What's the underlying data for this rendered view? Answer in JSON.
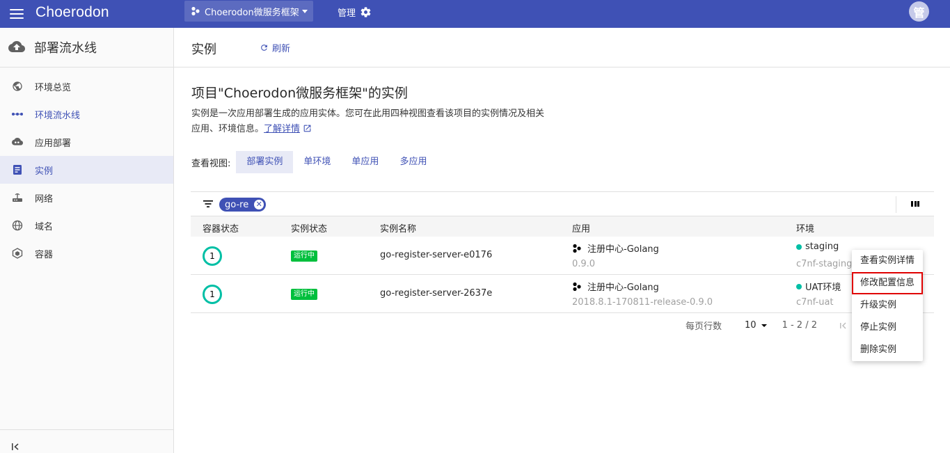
{
  "topbar": {
    "logo": "Choerodon",
    "project": "Choerodon微服务框架",
    "manage": "管理",
    "avatar": "管"
  },
  "sidebar": {
    "title": "部署流水线",
    "items": [
      {
        "label": "环境总览",
        "icon": "globe-icon"
      },
      {
        "label": "环境流水线",
        "icon": "pipeline-dots-icon"
      },
      {
        "label": "应用部署",
        "icon": "cloud-deploy-icon"
      },
      {
        "label": "实例",
        "icon": "instance-icon",
        "active": true
      },
      {
        "label": "网络",
        "icon": "router-icon"
      },
      {
        "label": "域名",
        "icon": "domain-globe-icon"
      },
      {
        "label": "容器",
        "icon": "container-icon"
      }
    ]
  },
  "page": {
    "title": "实例",
    "refresh": "刷新",
    "main_title": "项目\"Choerodon微服务框架\"的实例",
    "desc_line1": "实例是一次应用部署生成的应用实体。您可在此用四种视图查看该项目的实例情况及相关",
    "desc_line2": "应用、环境信息。",
    "learn_more": "了解详情"
  },
  "views": {
    "label": "查看视图:",
    "tabs": [
      "部署实例",
      "单环境",
      "单应用",
      "多应用"
    ],
    "active": "部署实例"
  },
  "filter": {
    "chip": "go-re"
  },
  "table": {
    "columns": [
      "容器状态",
      "实例状态",
      "实例名称",
      "应用",
      "环境"
    ],
    "rows": [
      {
        "pods": "1",
        "status": "运行中",
        "name": "go-register-server-e0176",
        "app": "注册中心-Golang",
        "version": "0.9.0",
        "env": "staging",
        "env_code": "c7nf-staging"
      },
      {
        "pods": "1",
        "status": "运行中",
        "name": "go-register-server-2637e",
        "app": "注册中心-Golang",
        "version": "2018.8.1-170811-release-0.9.0",
        "env": "UAT环境",
        "env_code": "c7nf-uat"
      }
    ]
  },
  "pager": {
    "rows_per_page": "每页行数",
    "size": "10",
    "range": "1 - 2 / 2"
  },
  "context_menu": {
    "items": [
      "查看实例详情",
      "修改配置信息",
      "升级实例",
      "停止实例",
      "删除实例"
    ],
    "highlighted": "修改配置信息"
  },
  "colors": {
    "primary": "#3f51b5",
    "running": "#00bf3d",
    "env_dot": "#00bfa5",
    "highlight": "#e00000"
  }
}
